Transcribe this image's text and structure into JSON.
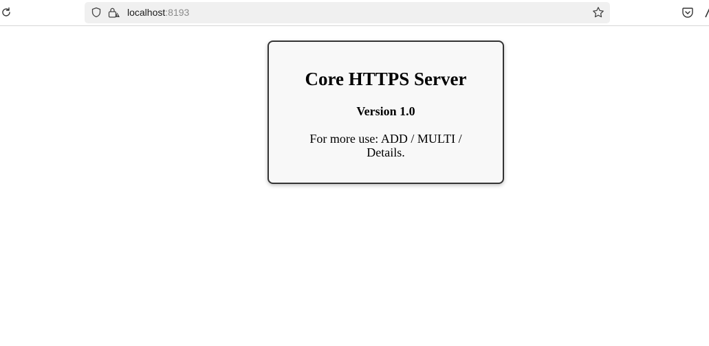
{
  "browser": {
    "url_host": "localhost",
    "url_port": ":8193",
    "icons": {
      "reload": "reload-icon",
      "shield": "shield-icon",
      "lock": "lock-warning-icon",
      "bookmark": "star-icon",
      "pocket": "pocket-icon",
      "account": "account-icon"
    }
  },
  "page": {
    "title": "Core HTTPS Server",
    "version": "Version 1.0",
    "description": "For more use: ADD / MULTI / Details."
  }
}
